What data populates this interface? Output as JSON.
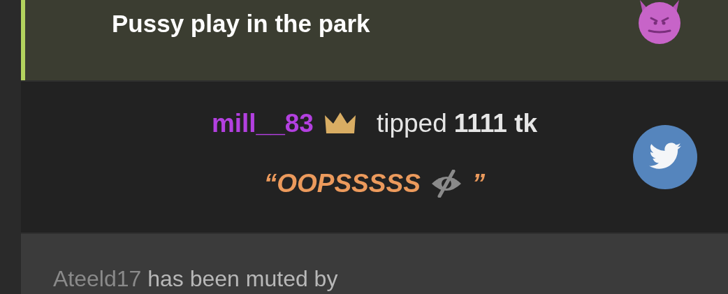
{
  "topic": {
    "title": "Pussy play in the park"
  },
  "tip": {
    "username": "mill__83",
    "verb": "tipped",
    "amount": "1111 tk",
    "quote_open": "“",
    "message": "OOPSSSSS",
    "quote_close": "”"
  },
  "notice": {
    "username": "Ateeld17",
    "text": "has been muted by"
  }
}
